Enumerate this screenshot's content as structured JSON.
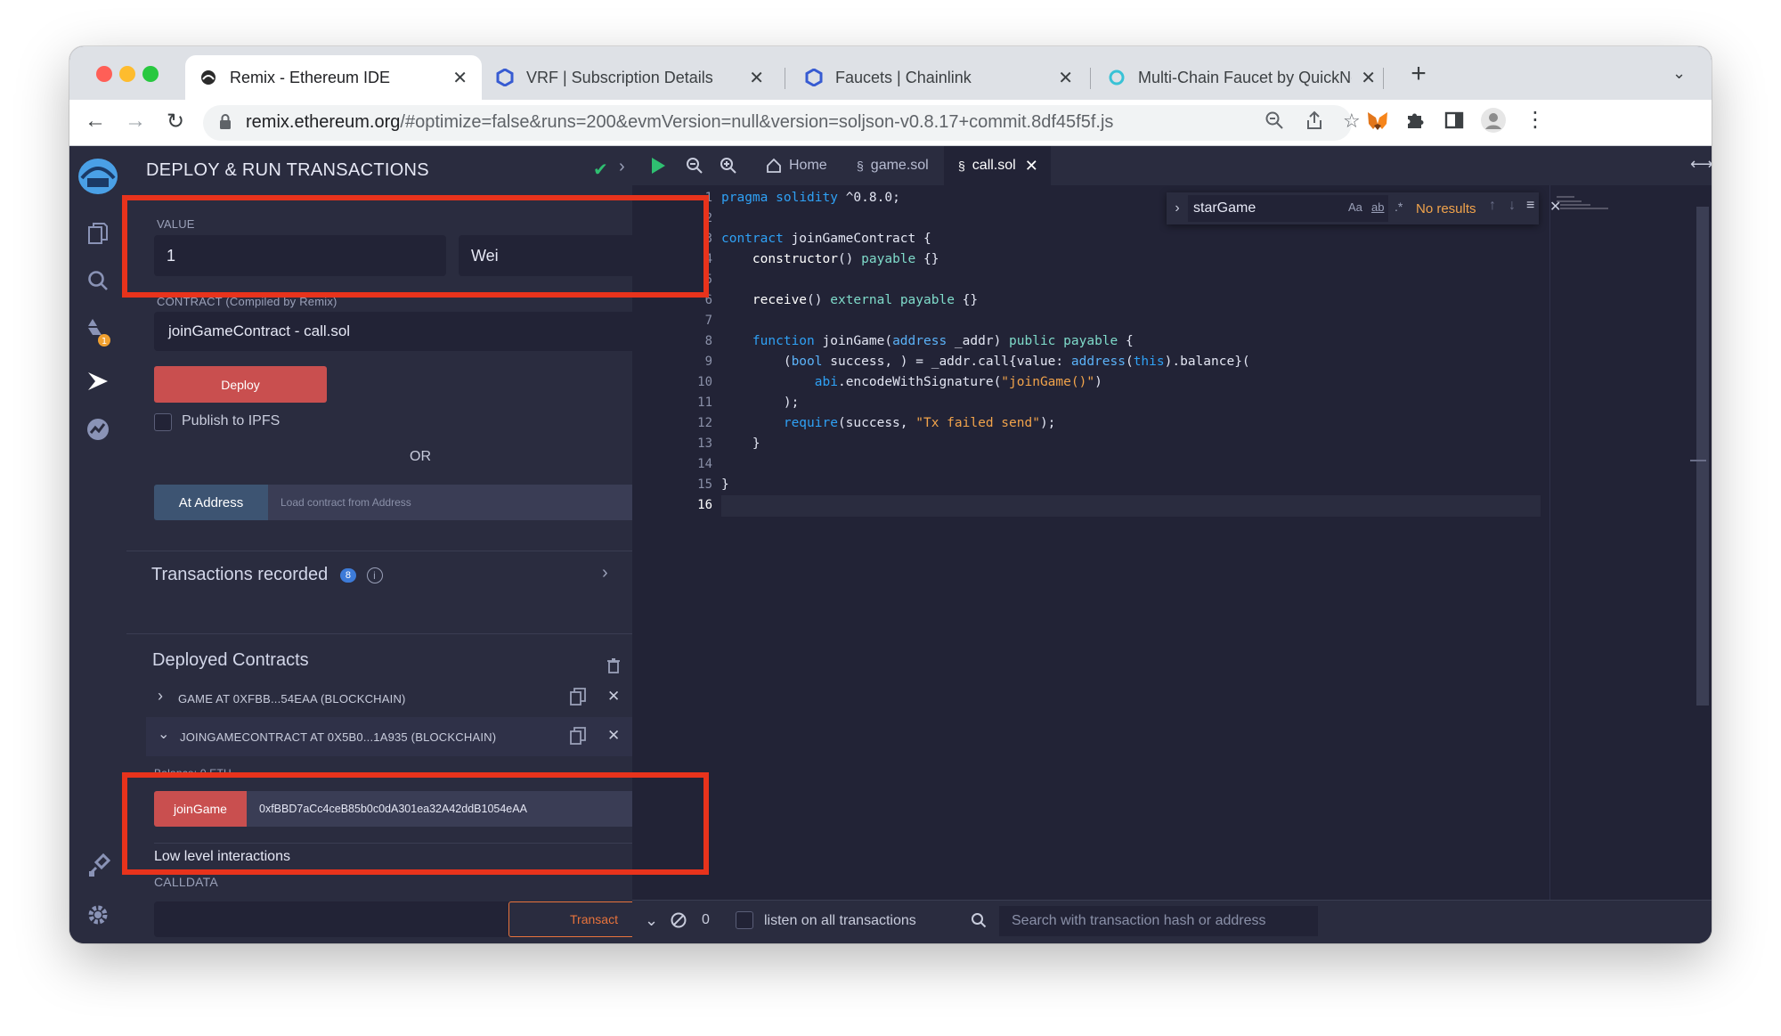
{
  "browser": {
    "tabs": [
      {
        "title": "Remix - Ethereum IDE",
        "active": true
      },
      {
        "title": "VRF | Subscription Details",
        "active": false
      },
      {
        "title": "Faucets | Chainlink",
        "active": false
      },
      {
        "title": "Multi-Chain Faucet by QuickNo",
        "active": false
      }
    ],
    "url_host": "remix.ethereum.org",
    "url_rest": "/#optimize=false&runs=200&evmVersion=null&version=soljson-v0.8.17+commit.8df45f5f.js"
  },
  "iconbar": {
    "badge": "1"
  },
  "panel": {
    "title": "DEPLOY & RUN TRANSACTIONS",
    "value_label": "VALUE",
    "value_amount": "1",
    "value_unit": "Wei",
    "contract_label": "CONTRACT (Compiled by Remix)",
    "contract_selected": "joinGameContract - call.sol",
    "deploy_label": "Deploy",
    "publish_label": "Publish to IPFS",
    "or_label": "OR",
    "at_address_label": "At Address",
    "at_address_placeholder": "Load contract from Address",
    "tx_recorded_label": "Transactions recorded",
    "tx_recorded_count": "8",
    "deployed_label": "Deployed Contracts",
    "contracts": [
      {
        "name": "GAME AT 0XFBB...54EAA (BLOCKCHAIN)"
      },
      {
        "name": "JOINGAMECONTRACT AT 0X5B0...1A935 (BLOCKCHAIN)"
      }
    ],
    "balance_label": "Balance: 0 ETH",
    "joingame_label": "joinGame",
    "joingame_value": "0xfBBD7aCc4ceB85b0c0dA301ea32A42ddB1054eAA",
    "low_level_label": "Low level interactions",
    "calldata_label": "CALLDATA",
    "transact_label": "Transact"
  },
  "editor": {
    "tabs": [
      "Home",
      "game.sol",
      "call.sol"
    ],
    "active_tab": "call.sol",
    "find_query": "starGame",
    "find_opt_case": "Aa",
    "find_opt_word": "ab",
    "find_opt_regex": ".*",
    "find_result": "No results",
    "lines": [
      "1",
      "2",
      "3",
      "4",
      "5",
      "6",
      "7",
      "8",
      "9",
      "10",
      "11",
      "12",
      "13",
      "14",
      "15",
      "16"
    ]
  },
  "terminal": {
    "count": "0",
    "listen_label": "listen on all transactions",
    "search_placeholder": "Search with transaction hash or address"
  },
  "colors": {
    "accent_red": "#e8331c",
    "deploy": "#c94f4f",
    "keyword": "#2fa1f5",
    "string": "#f1a34b",
    "bg": "#222336",
    "panel": "#2a2c3f"
  }
}
